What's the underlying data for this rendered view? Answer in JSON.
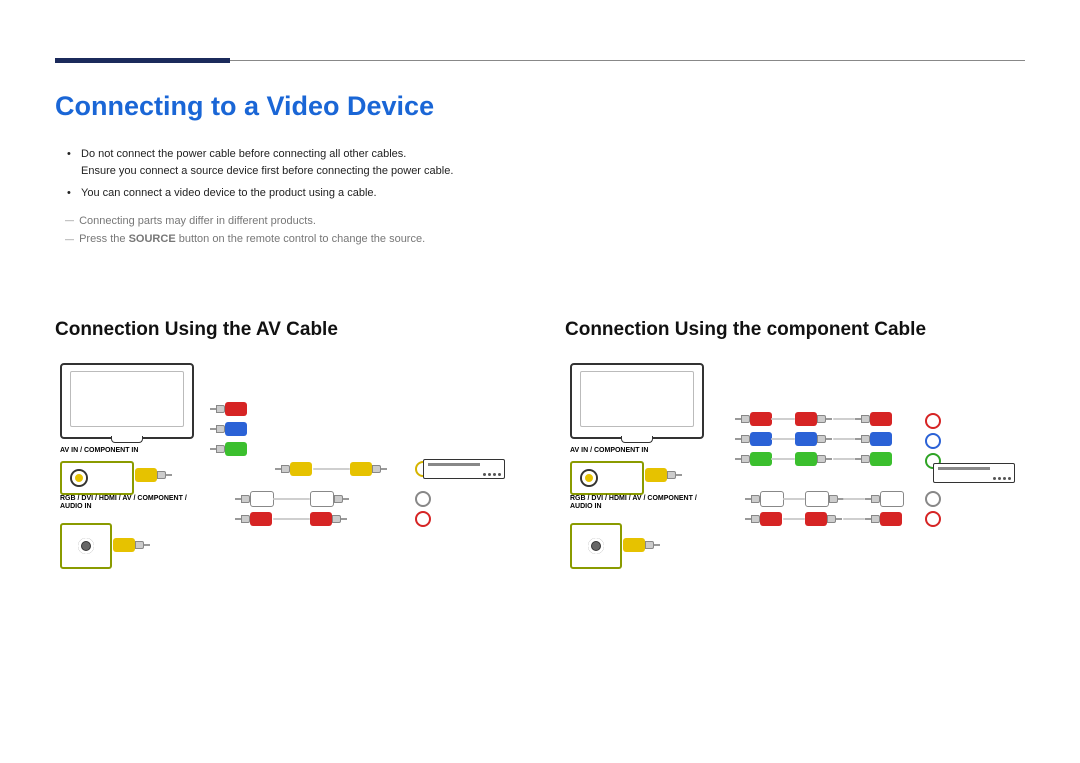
{
  "header": {
    "title": "Connecting to a Video Device"
  },
  "notes": {
    "b1a": "Do not connect the power cable before connecting all other cables.",
    "b1b": "Ensure you connect a source device first before connecting the power cable.",
    "b2": "You can connect a video device to the product using a cable.",
    "d1": "Connecting parts may differ in different products.",
    "d2_pre": "Press the ",
    "d2_bold": "SOURCE",
    "d2_post": " button on the remote control to change the source."
  },
  "left": {
    "title": "Connection Using the AV Cable",
    "port_label_1": "AV IN / COMPONENT IN",
    "port_label_2": "RGB / DVI / HDMI / AV / COMPONENT / AUDIO IN"
  },
  "right": {
    "title": "Connection Using the component Cable",
    "port_label_1": "AV IN / COMPONENT IN",
    "port_label_2": "RGB / DVI / HDMI / AV / COMPONENT / AUDIO IN"
  },
  "colors": {
    "accent_blue": "#1a66d6",
    "rule_dark": "#1b2a5b",
    "plug_red": "#d62424",
    "plug_green": "#3bbf2e",
    "plug_blue": "#2b62d6",
    "plug_yellow": "#e6c200",
    "outline_olive": "#8a9b00"
  }
}
